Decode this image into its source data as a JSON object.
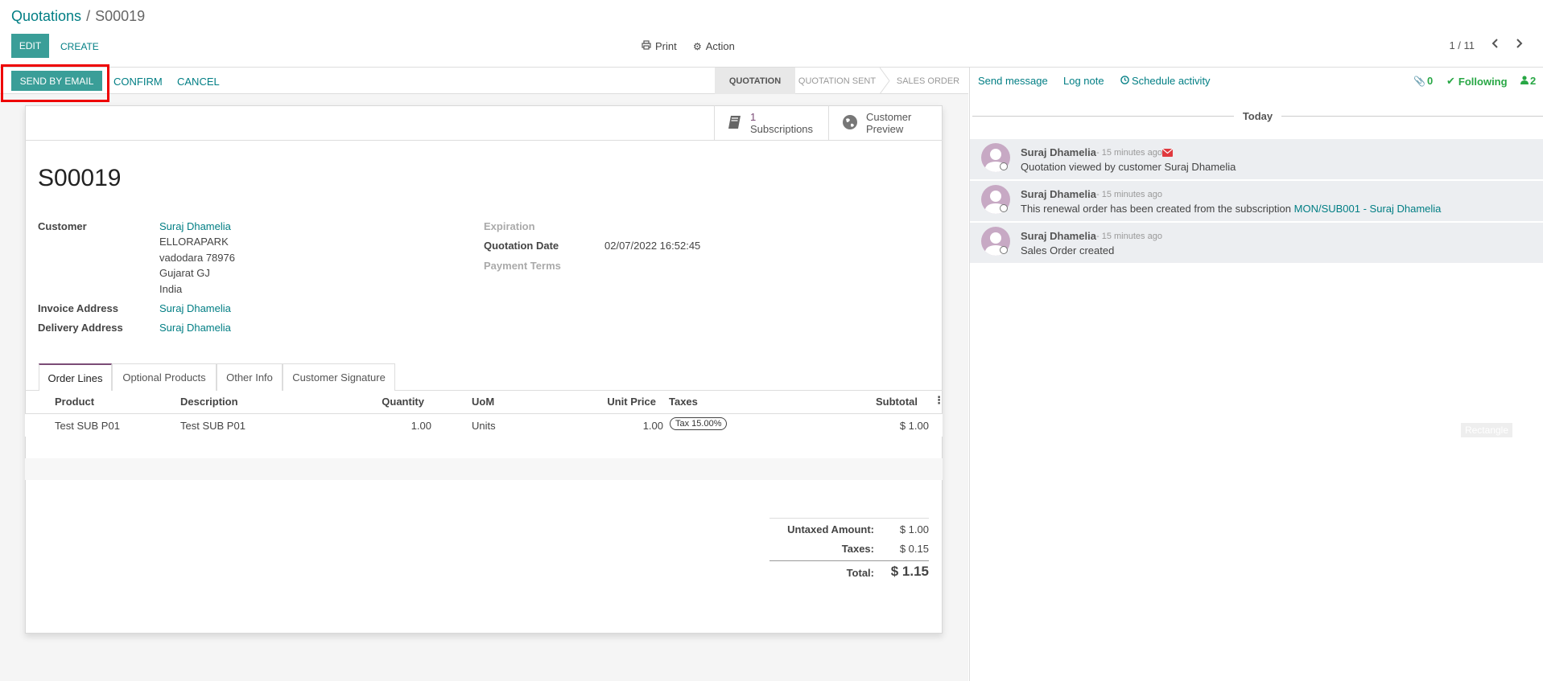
{
  "breadcrumb": {
    "parent": "Quotations",
    "separator": "/",
    "current": "S00019"
  },
  "control_panel": {
    "edit_label": "EDIT",
    "create_label": "CREATE",
    "print_label": "Print",
    "action_label": "Action",
    "pager": "1 / 11"
  },
  "statusbar": {
    "send_email_label": "SEND BY EMAIL",
    "confirm_label": "CONFIRM",
    "cancel_label": "CANCEL",
    "stages": [
      "QUOTATION",
      "QUOTATION SENT",
      "SALES ORDER"
    ]
  },
  "smart_buttons": {
    "subscriptions_count": "1",
    "subscriptions_label": "Subscriptions",
    "preview_line1": "Customer",
    "preview_line2": "Preview"
  },
  "record": {
    "name": "S00019",
    "customer_label": "Customer",
    "customer_name": "Suraj Dhamelia",
    "address": [
      "ELLORAPARK",
      "vadodara 78976",
      "Gujarat GJ",
      "India"
    ],
    "invoice_label": "Invoice Address",
    "invoice_value": "Suraj Dhamelia",
    "delivery_label": "Delivery Address",
    "delivery_value": "Suraj Dhamelia",
    "expiration_label": "Expiration",
    "quotation_date_label": "Quotation Date",
    "quotation_date_value": "02/07/2022 16:52:45",
    "payment_terms_label": "Payment Terms"
  },
  "tabs": [
    "Order Lines",
    "Optional Products",
    "Other Info",
    "Customer Signature"
  ],
  "order_lines": {
    "headers": {
      "product": "Product",
      "description": "Description",
      "quantity": "Quantity",
      "uom": "UoM",
      "unit_price": "Unit Price",
      "taxes": "Taxes",
      "subtotal": "Subtotal"
    },
    "rows": [
      {
        "product": "Test SUB P01",
        "description": "Test SUB P01",
        "quantity": "1.00",
        "uom": "Units",
        "unit_price": "1.00",
        "taxes": "Tax 15.00%",
        "subtotal": "$ 1.00"
      }
    ]
  },
  "totals": {
    "untaxed_label": "Untaxed Amount:",
    "untaxed_value": "$ 1.00",
    "taxes_label": "Taxes:",
    "taxes_value": "$ 0.15",
    "total_label": "Total:",
    "total_value": "$ 1.15"
  },
  "chatter": {
    "send_message": "Send message",
    "log_note": "Log note",
    "schedule_activity": "Schedule activity",
    "attachments_count": "0",
    "following_label": "Following",
    "followers_count": "2",
    "today_label": "Today",
    "messages": [
      {
        "author": "Suraj Dhamelia",
        "ago": "- 15 minutes ago",
        "text": "Quotation viewed by customer Suraj Dhamelia",
        "link": ""
      },
      {
        "author": "Suraj Dhamelia",
        "ago": "- 15 minutes ago",
        "text": "This renewal order has been created from the subscription ",
        "link": "MON/SUB001 - Suraj Dhamelia"
      },
      {
        "author": "Suraj Dhamelia",
        "ago": "- 15 minutes ago",
        "text": "Sales Order created",
        "link": ""
      }
    ],
    "ghost_label": "Rectangle"
  },
  "colors": {
    "accent": "#017e84",
    "primary_button": "#3a9e98",
    "highlight": "#e00000",
    "avatar": "#c7a9c4",
    "following": "#28a745"
  }
}
